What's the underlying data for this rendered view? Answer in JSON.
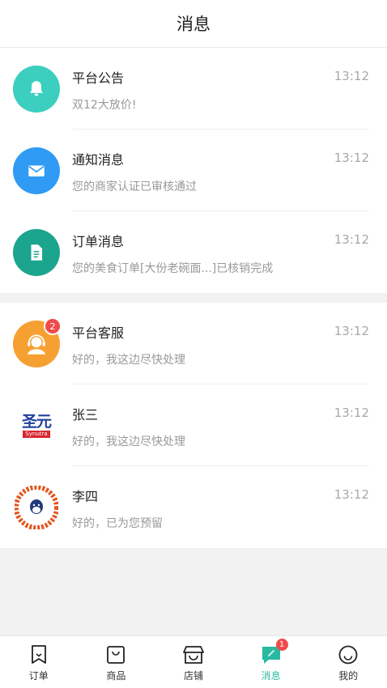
{
  "header": {
    "title": "消息"
  },
  "system_messages": [
    {
      "name": "平台公告",
      "time": "13:12",
      "preview": "双12大放价!",
      "icon": "bell-icon",
      "color": "#3ccfbf"
    },
    {
      "name": "通知消息",
      "time": "13:12",
      "preview": "您的商家认证已审核通过",
      "icon": "envelope-icon",
      "color": "#2f9bf4"
    },
    {
      "name": "订单消息",
      "time": "13:12",
      "preview": "您的美食订单[大份老碗面...]已核销完成",
      "icon": "document-icon",
      "color": "#1ba58e"
    }
  ],
  "chats": [
    {
      "name": "平台客服",
      "time": "13:12",
      "preview": "好的，我这边尽快处理",
      "badge": "2",
      "icon": "customer-service-icon",
      "color": "#f7a032"
    },
    {
      "name": "张三",
      "time": "13:12",
      "preview": "好的，我这边尽快处理",
      "icon": "shengyuan-logo-icon",
      "logo_text": "圣元",
      "logo_sub": "Synutra"
    },
    {
      "name": "李四",
      "time": "13:12",
      "preview": "好的，已为您预留",
      "icon": "bape-logo-icon"
    }
  ],
  "tabs": [
    {
      "label": "订单",
      "icon": "order-icon"
    },
    {
      "label": "商品",
      "icon": "bag-icon"
    },
    {
      "label": "店铺",
      "icon": "store-icon"
    },
    {
      "label": "消息",
      "icon": "message-icon",
      "active": true,
      "badge": "1"
    },
    {
      "label": "我的",
      "icon": "smile-icon"
    }
  ],
  "colors": {
    "accent": "#28b9a0",
    "badge": "#ef4b4b"
  }
}
